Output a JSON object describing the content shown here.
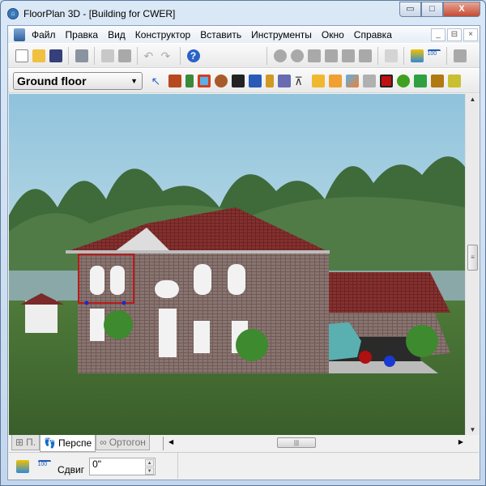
{
  "window": {
    "title": "FloorPlan 3D - [Building for CWER]",
    "minimize": "▭",
    "maximize": "□",
    "close": "X"
  },
  "menu": {
    "items": [
      "Файл",
      "Правка",
      "Вид",
      "Конструктор",
      "Вставить",
      "Инструменты",
      "Окно",
      "Справка"
    ],
    "mdi": [
      "_",
      "⊟",
      "×"
    ]
  },
  "toolbar1": {
    "icons": [
      "new-document",
      "open-folder",
      "save",
      "print",
      "copy",
      "paste",
      "undo",
      "redo",
      "help",
      "zoom-in",
      "zoom-out",
      "zoom-window",
      "zoom-pan",
      "zoom-previous",
      "zoom-fit",
      "pan-hand",
      "floor-level",
      "dimension"
    ]
  },
  "toolbar2": {
    "floor_select": "Ground floor",
    "tools": [
      "select-arrow",
      "wall",
      "door",
      "window",
      "roof",
      "stairs",
      "railing",
      "column",
      "house-object",
      "camera-tripod",
      "cabinet",
      "furniture",
      "terrain",
      "plumbing",
      "fireplace",
      "landscape-shrub",
      "ramp",
      "table",
      "misc"
    ]
  },
  "tabs": [
    {
      "label": "П.",
      "icon": "plan-grid"
    },
    {
      "label": "Перспе",
      "icon": "footprints",
      "active": true
    },
    {
      "label": "Ортогон",
      "icon": "binoculars"
    }
  ],
  "status": {
    "shift_label": "Сдвиг",
    "shift_value": "0\""
  },
  "colors": {
    "accent": "#3a78b8",
    "roof": "#7a2a2a",
    "selection": "#cc0000"
  }
}
